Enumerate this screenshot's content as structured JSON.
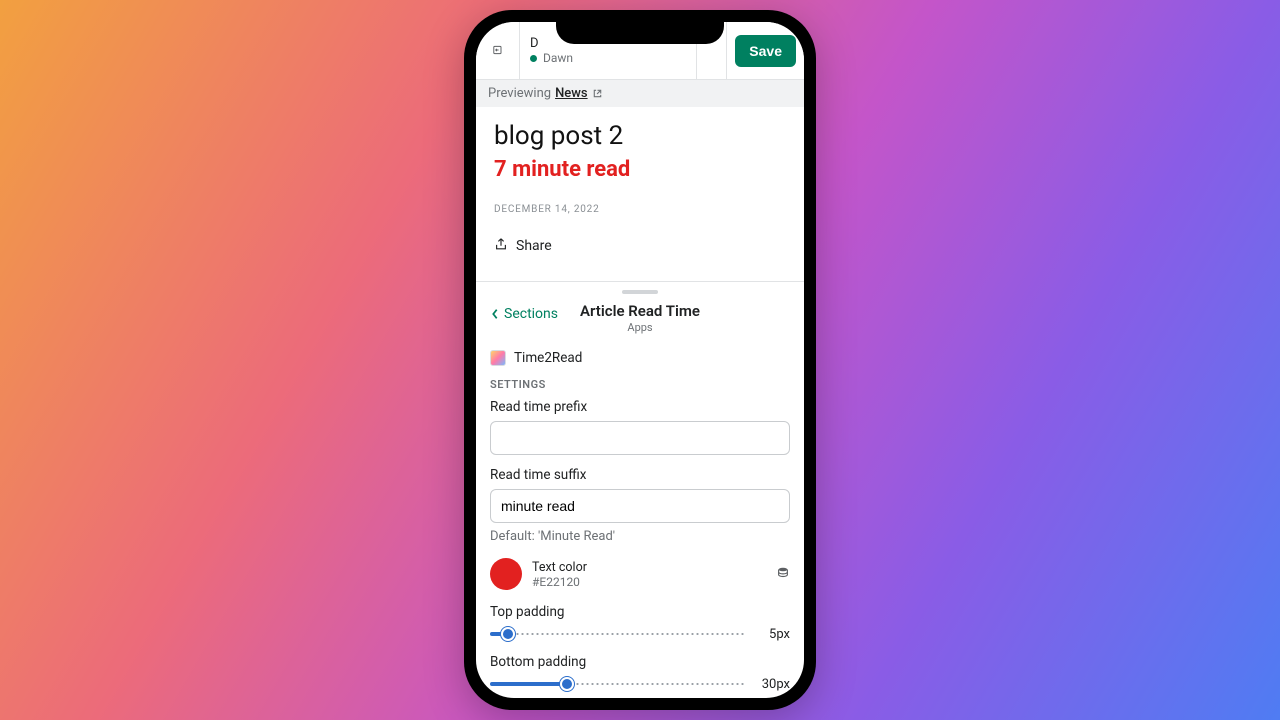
{
  "topbar": {
    "theme_initial": "D",
    "theme_name": "Dawn",
    "save_label": "Save"
  },
  "preview_strip": {
    "prefix": "Previewing ",
    "link_label": "News"
  },
  "article": {
    "title": "blog post 2",
    "read_time": "7 minute read",
    "date": "DECEMBER 14, 2022",
    "share_label": "Share"
  },
  "panel": {
    "back_label": "Sections",
    "title": "Article Read Time",
    "subtitle": "Apps",
    "app_name": "Time2Read",
    "settings_heading": "SETTINGS",
    "fields": {
      "prefix_label": "Read time prefix",
      "prefix_value": "",
      "suffix_label": "Read time suffix",
      "suffix_value": "minute read",
      "suffix_helper": "Default: 'Minute Read'",
      "text_color_label": "Text color",
      "text_color_value": "#E22120",
      "top_padding_label": "Top padding",
      "top_padding_value": "5px",
      "bottom_padding_label": "Bottom padding",
      "bottom_padding_value": "30px"
    }
  },
  "colors": {
    "accent": "#008060",
    "read_time": "#E22120",
    "slider": "#2c6ecb"
  }
}
